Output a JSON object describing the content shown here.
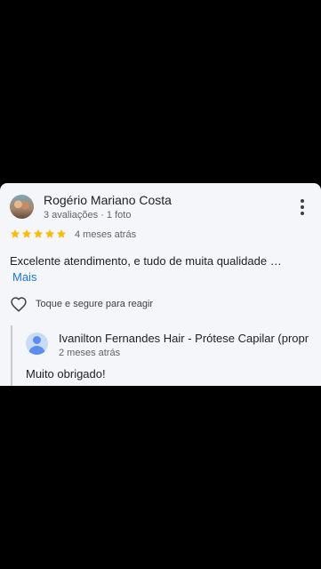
{
  "review": {
    "author": "Rogério Mariano Costa",
    "meta": "3 avaliações · 1 foto",
    "rating": 5,
    "time": "4 meses atrás",
    "text": "Excelente atendimento, e tudo de muita qualidade …",
    "more_label": "Mais",
    "react_hint": "Toque e segure para reagir"
  },
  "owner_reply": {
    "author": "Ivanilton Fernandes Hair - Prótese Capilar (propr",
    "time": "2 meses atrás",
    "text": "Muito obrigado!"
  },
  "colors": {
    "star": "#fbbc04",
    "link": "#1a73e8",
    "card_bg": "#f4f6f9"
  }
}
